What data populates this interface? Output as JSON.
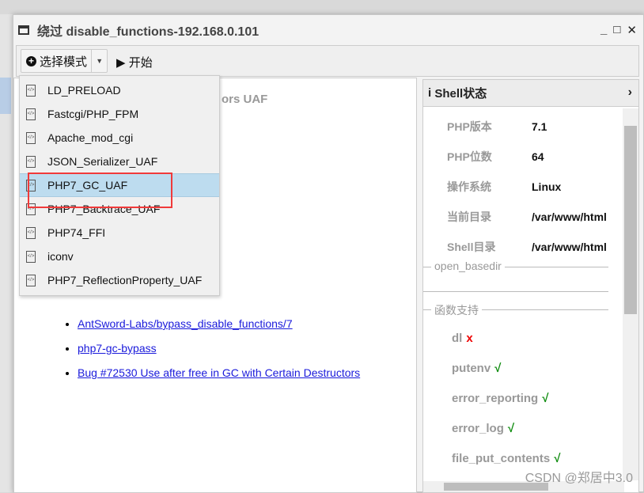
{
  "window": {
    "title": "绕过 disable_functions-192.168.0.101",
    "minimize": "_",
    "maximize": "□",
    "close": "✕"
  },
  "toolbar": {
    "select_mode": "选择模式",
    "start": "开始"
  },
  "content": {
    "heading_fragment": "ors UAF",
    "links": [
      "AntSword-Labs/bypass_disable_functions/7",
      "php7-gc-bypass",
      "Bug #72530 Use after free in GC with Certain Destructors"
    ]
  },
  "dropdown": {
    "items": [
      "LD_PRELOAD",
      "Fastcgi/PHP_FPM",
      "Apache_mod_cgi",
      "JSON_Serializer_UAF",
      "PHP7_GC_UAF",
      "PHP7_Backtrace_UAF",
      "PHP74_FFI",
      "iconv",
      "PHP7_ReflectionProperty_UAF"
    ],
    "selected": "PHP7_GC_UAF"
  },
  "shell": {
    "title": "Shell状态",
    "rows": [
      {
        "k": "PHP版本",
        "v": "7.1"
      },
      {
        "k": "PHP位数",
        "v": "64"
      },
      {
        "k": "操作系统",
        "v": "Linux"
      },
      {
        "k": "当前目录",
        "v": "/var/www/html"
      },
      {
        "k": "Shell目录",
        "v": "/var/www/html"
      }
    ],
    "open_basedir": "open_basedir",
    "func_support": "函数支持",
    "funcs": [
      {
        "name": "dl",
        "mark": "x"
      },
      {
        "name": "putenv",
        "mark": "√"
      },
      {
        "name": "error_reporting",
        "mark": "√"
      },
      {
        "name": "error_log",
        "mark": "√"
      },
      {
        "name": "file_put_contents",
        "mark": "√"
      }
    ]
  },
  "watermark": "CSDN @郑居中3.0",
  "colors": {
    "highlight": "#bddcef",
    "annotation": "#f03a3a",
    "link": "#1a1adb",
    "ok": "#0a8a0a",
    "fail": "#e00000"
  }
}
